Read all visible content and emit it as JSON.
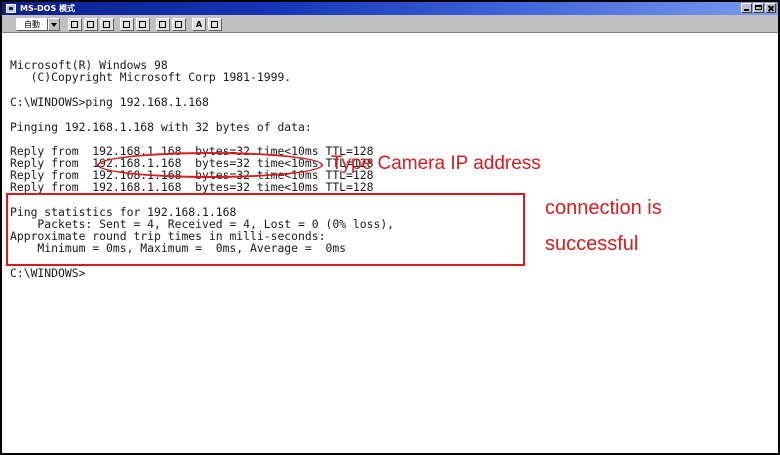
{
  "window": {
    "title": "MS-DOS 模式"
  },
  "toolbar": {
    "font_size_value": "自動",
    "bold_font_label": "A"
  },
  "console": {
    "lines": [
      "Microsoft(R) Windows 98",
      "   (C)Copyright Microsoft Corp 1981-1999.",
      "",
      "C:\\WINDOWS>ping 192.168.1.168",
      "",
      "Pinging 192.168.1.168 with 32 bytes of data:",
      "",
      "Reply from  192.168.1.168  bytes=32 time<10ms TTL=128",
      "Reply from  192.168.1.168  bytes=32 time<10ms TTL=128",
      "Reply from  192.168.1.168  bytes=32 time<10ms TTL=128",
      "Reply from  192.168.1.168  bytes=32 time<10ms TTL=128",
      "",
      "Ping statistics for 192.168.1.168",
      "    Packets: Sent = 4, Received = 4, Lost = 0 (0% loss),",
      "Approximate round trip times in milli-seconds:",
      "    Minimum = 0ms, Maximum =  0ms, Average =  0ms",
      "",
      "C:\\WINDOWS>"
    ]
  },
  "annotations": {
    "type_ip": "Type Camera IP address",
    "connection_line1": "connection is",
    "connection_line2": "successful",
    "color": "#d61c1c"
  }
}
